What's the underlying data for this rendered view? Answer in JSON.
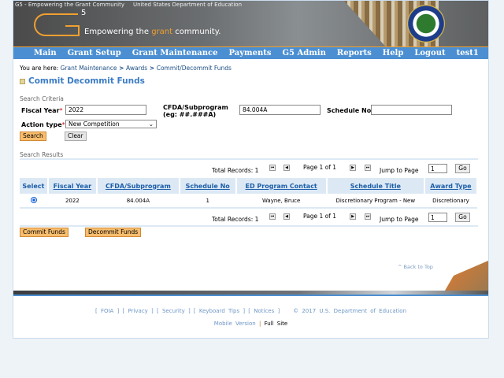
{
  "banner": {
    "logo_alt": "G5 - Empowering the Grant Community",
    "seal_alt": "United States Department of Education",
    "logo_mark": "5",
    "tagline_pre": "Empowering the ",
    "tagline_accent": "grant",
    "tagline_post": " community."
  },
  "nav": [
    "Main",
    "Grant Setup",
    "Grant Maintenance",
    "Payments",
    "G5 Admin",
    "Reports",
    "Help",
    "Logout",
    "test1"
  ],
  "breadcrumb": {
    "prefix": "You are here: ",
    "items": [
      "Grant Maintenance",
      "Awards",
      "Commit/Decommit Funds"
    ],
    "sep": " > "
  },
  "page_title": "Commit Decommit Funds",
  "search": {
    "section": "Search Criteria",
    "fiscal_year_label": "Fiscal Year",
    "fiscal_year": "2022",
    "cfda_label": "CFDA/Subprogram",
    "cfda_hint": "(eg: ##.###A)",
    "cfda": "84.004A",
    "schedule_label": "Schedule No",
    "schedule": "",
    "action_label": "Action type",
    "action": "New Competition",
    "required": "*",
    "search_btn": "Search",
    "clear_btn": "Clear"
  },
  "results": {
    "section": "Search Results",
    "total": "Total Records: 1",
    "page": "Page 1 of 1",
    "jump": "Jump to Page",
    "jump_value": "1",
    "go": "Go",
    "columns": [
      "Select",
      "Fiscal Year",
      "CFDA/Subprogram",
      "Schedule No",
      "ED Program Contact",
      "Schedule Title",
      "Award Type"
    ],
    "rows": [
      {
        "fiscal_year": "2022",
        "cfda": "84.004A",
        "schedule": "1",
        "contact": "Wayne, Bruce",
        "title": "Discretionary Program - New",
        "award_type": "Discretionary",
        "selected": true
      }
    ]
  },
  "actions": {
    "commit": "Commit Funds",
    "decommit": "Decommit Funds"
  },
  "back_to_top": "^ Back to Top",
  "footer": {
    "links": [
      "FOIA",
      "Privacy",
      "Security",
      "Keyboard Tips",
      "Notices"
    ],
    "copyright": "© 2017 U.S. Department of Education",
    "mobile": "Mobile Version",
    "sep": "|",
    "full": "Full Site"
  }
}
